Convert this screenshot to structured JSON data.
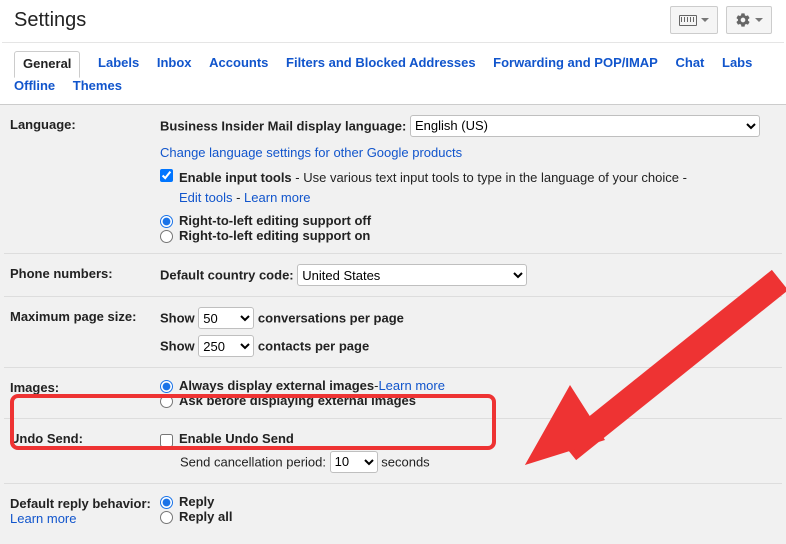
{
  "header": {
    "title": "Settings"
  },
  "tabs": {
    "general": "General",
    "labels": "Labels",
    "inbox": "Inbox",
    "accounts": "Accounts",
    "filters": "Filters and Blocked Addresses",
    "forwarding": "Forwarding and POP/IMAP",
    "chat": "Chat",
    "labs": "Labs",
    "offline": "Offline",
    "themes": "Themes"
  },
  "language": {
    "label": "Language:",
    "displayLabel": "Business Insider Mail display language:",
    "selected": "English (US)",
    "changeLink": "Change language settings for other Google products",
    "enableInputBold": "Enable input tools",
    "enableInputRest": " - Use various text input tools to type in the language of your choice - ",
    "editTools": "Edit tools",
    "dashLearn": " - ",
    "learnMore": "Learn more",
    "rtlOff": "Right-to-left editing support off",
    "rtlOn": "Right-to-left editing support on"
  },
  "phone": {
    "label": "Phone numbers:",
    "defaultCode": "Default country code:",
    "selected": "United States"
  },
  "pageSize": {
    "label": "Maximum page size:",
    "showA": "Show",
    "convVal": "50",
    "convRest": "conversations per page",
    "showB": "Show",
    "contactsVal": "250",
    "contactsRest": "contacts per page"
  },
  "images": {
    "label": "Images:",
    "always": "Always display external images",
    "dashLearn": " - ",
    "learnMore": "Learn more",
    "ask": "Ask before displaying external images"
  },
  "undo": {
    "label": "Undo Send:",
    "enable": "Enable Undo Send",
    "period": "Send cancellation period:",
    "val": "10",
    "seconds": "seconds"
  },
  "reply": {
    "label": "Default reply behavior:",
    "learnMore": "Learn more",
    "reply": "Reply",
    "replyAll": "Reply all"
  }
}
